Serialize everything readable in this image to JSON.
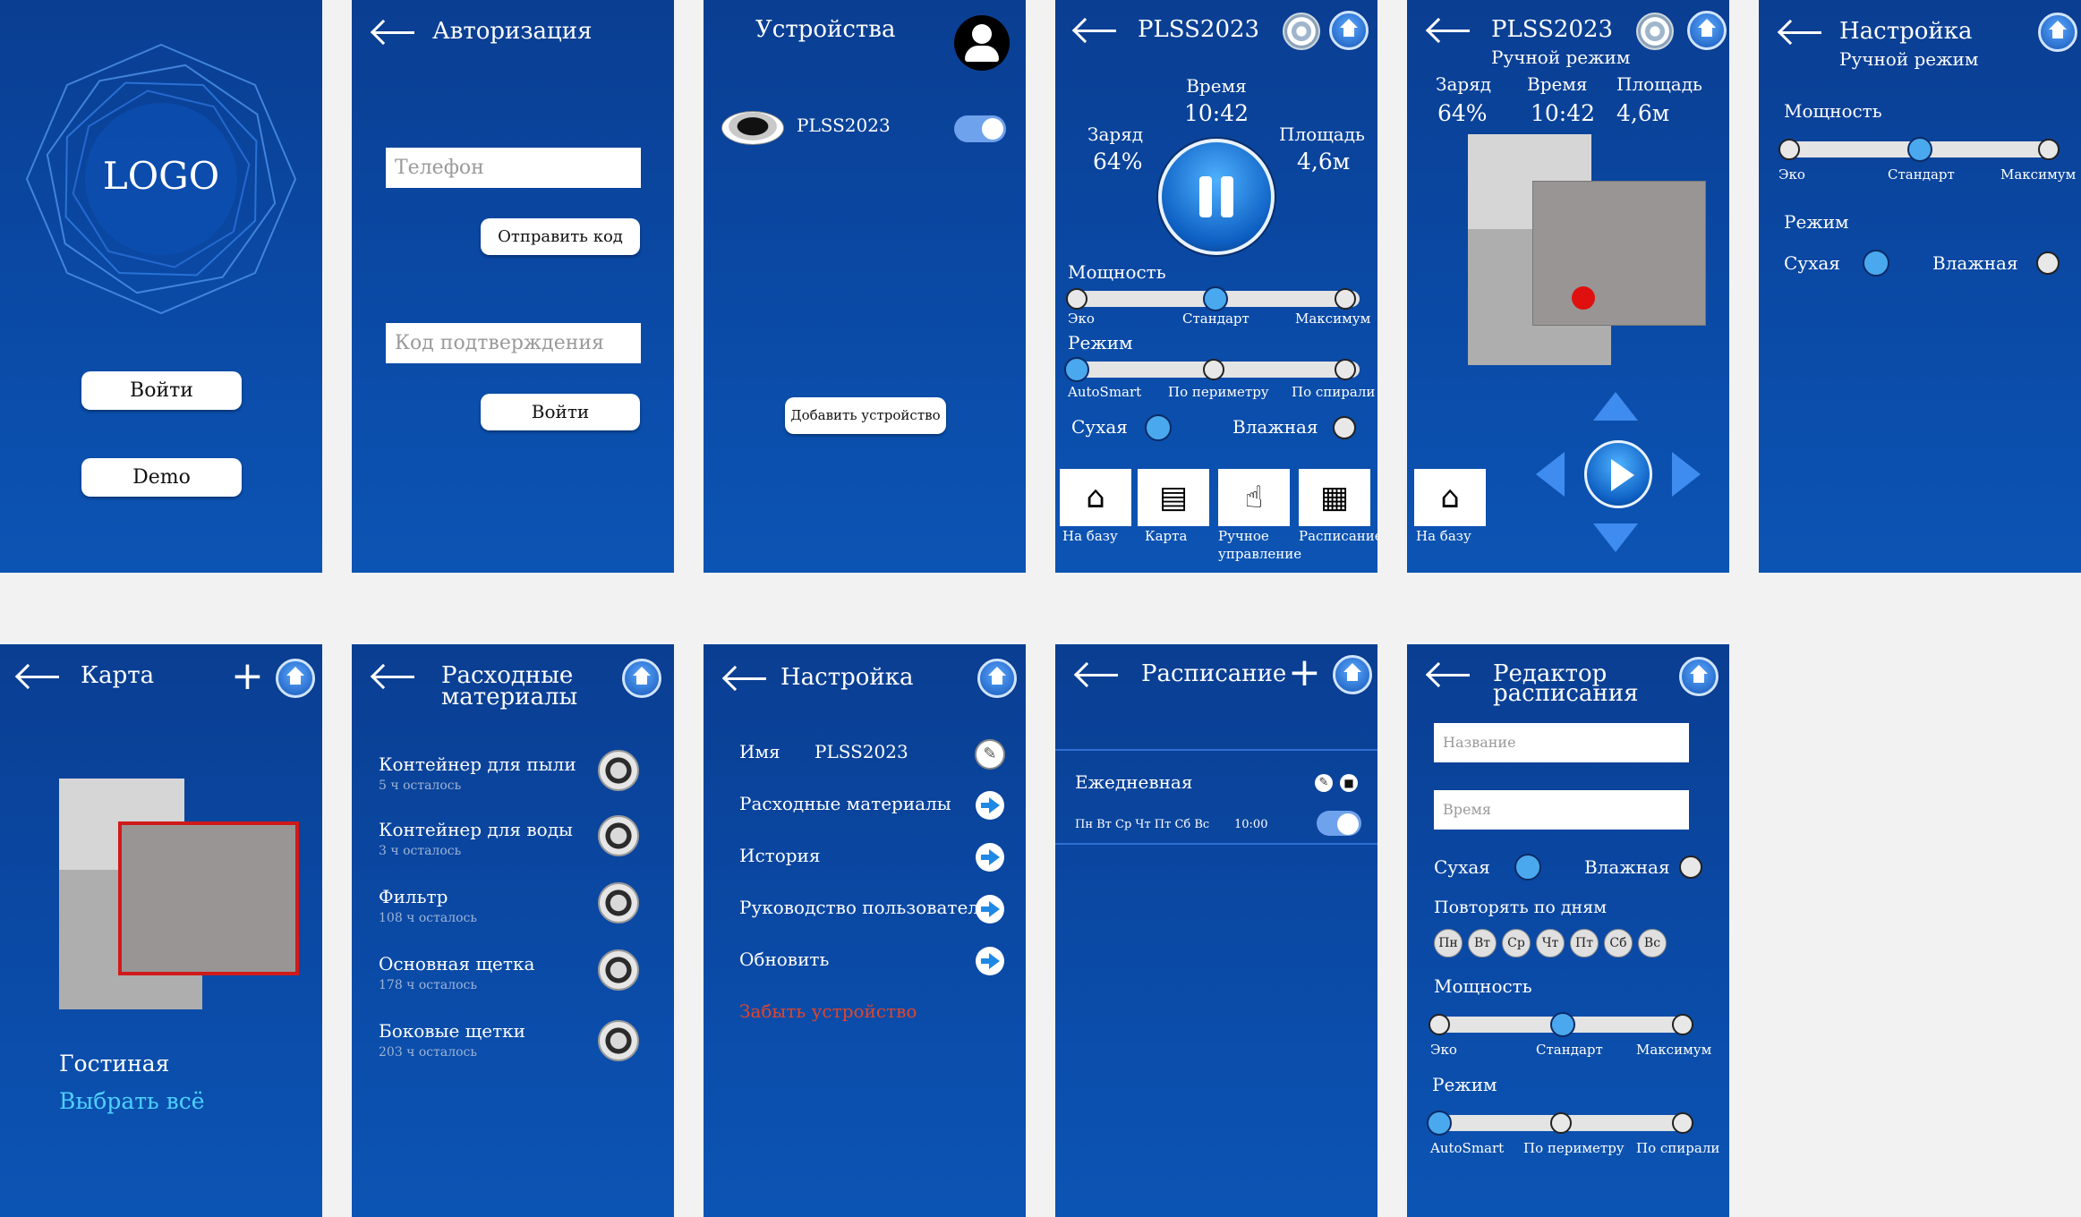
{
  "s1": {
    "logo": "LOGO",
    "login": "Войти",
    "demo": "Demo"
  },
  "s2": {
    "title": "Авторизация",
    "phone_ph": "Телефон",
    "send": "Отправить код",
    "code_ph": "Код подтверждения",
    "login": "Войти"
  },
  "s3": {
    "title": "Устройства",
    "device": "PLSS2023",
    "add": "Добавить устройство"
  },
  "s4": {
    "title": "PLSS2023",
    "time_l": "Время",
    "time_v": "10:42",
    "charge_l": "Заряд",
    "charge_v": "64%",
    "area_l": "Площадь",
    "area_v": "4,6м",
    "power": "Мощность",
    "eco": "Эко",
    "std": "Стандарт",
    "max": "Максимум",
    "mode": "Режим",
    "m1": "AutoSmart",
    "m2": "По периметру",
    "m3": "По спирали",
    "dry": "Сухая",
    "wet": "Влажная",
    "ic1": "На базу",
    "ic2": "Карта",
    "ic3a": "Ручное",
    "ic3b": "управление",
    "ic4": "Расписание"
  },
  "s5": {
    "title": "PLSS2023",
    "sub": "Ручной режим",
    "charge_l": "Заряд",
    "charge_v": "64%",
    "time_l": "Время",
    "time_v": "10:42",
    "area_l": "Площадь",
    "area_v": "4,6м",
    "base": "На базу"
  },
  "s6": {
    "title": "Настройка",
    "sub": "Ручной режим",
    "power": "Мощность",
    "eco": "Эко",
    "std": "Стандарт",
    "max": "Максимум",
    "mode": "Режим",
    "dry": "Сухая",
    "wet": "Влажная"
  },
  "s7": {
    "title": "Карта",
    "room": "Гостиная",
    "select": "Выбрать всё"
  },
  "s8": {
    "title1": "Расходные",
    "title2": "материалы",
    "items": [
      {
        "name": "Контейнер для пыли",
        "left": "5 ч осталось"
      },
      {
        "name": "Контейнер для воды",
        "left": "3 ч осталось"
      },
      {
        "name": "Фильтр",
        "left": "108 ч осталось"
      },
      {
        "name": "Основная щетка",
        "left": "178 ч осталось"
      },
      {
        "name": "Боковые щетки",
        "left": "203 ч осталось"
      }
    ]
  },
  "s9": {
    "title": "Настройка",
    "name_l": "Имя",
    "name_v": "PLSS2023",
    "r1": "Расходные материалы",
    "r2": "История",
    "r3": "Руководство пользователя",
    "r4": "Обновить",
    "forget": "Забыть устройство"
  },
  "s10": {
    "title": "Расписание",
    "item": "Ежедневная",
    "days": "Пн Вт Ср Чт Пт Сб Вс",
    "time": "10:00"
  },
  "s11": {
    "title1": "Редактор",
    "title2": "расписания",
    "name_ph": "Название",
    "time_ph": "Время",
    "dry": "Сухая",
    "wet": "Влажная",
    "repeat": "Повторять по дням",
    "days": [
      "Пн",
      "Вт",
      "Ср",
      "Чт",
      "Пт",
      "Сб",
      "Вс"
    ],
    "power": "Мощность",
    "eco": "Эко",
    "std": "Стандарт",
    "max": "Максимум",
    "mode": "Режим",
    "m1": "AutoSmart",
    "m2": "По периметру",
    "m3": "По спирали"
  },
  "colors": {
    "accent": "#4aa9ee",
    "bg": "#0a48a3",
    "danger": "#e2452b"
  }
}
